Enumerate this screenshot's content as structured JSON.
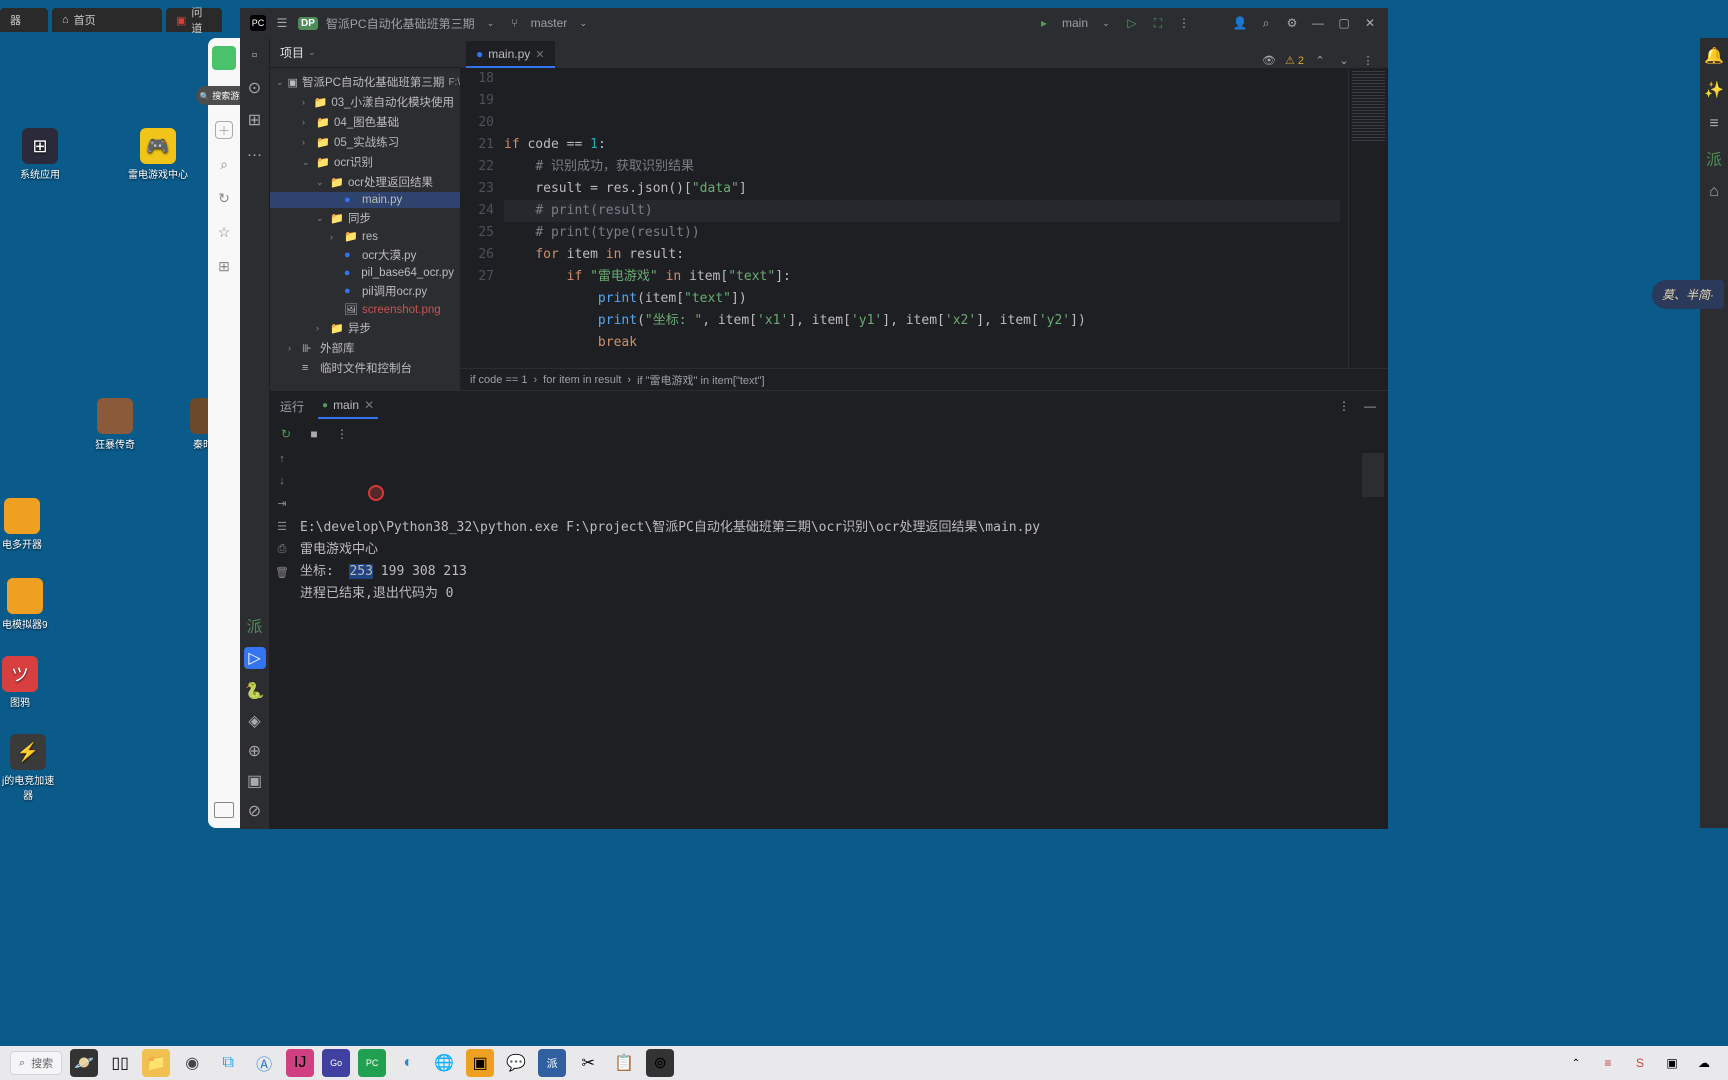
{
  "browser_tabs": [
    {
      "icon": "器",
      "label": "器"
    },
    {
      "icon": "⌂",
      "label": "首页"
    },
    {
      "icon": "▣",
      "label": "问道"
    }
  ],
  "desktop_icons": {
    "system": "系统应用",
    "leidian": "雷电游戏中心",
    "duokai": "电多开器",
    "simulator": "电模拟器9",
    "tuya": "图鸦",
    "booster": "j的电竞加速\n器",
    "kuangbao": "狂暴传奇",
    "qinshi": "秦时传"
  },
  "side_app": {
    "search": "搜索游戏"
  },
  "titlebar": {
    "project": "智派PC自动化基础班第三期",
    "branch": "master",
    "run_config": "main"
  },
  "tree": {
    "header": "项目",
    "root": "智派PC自动化基础班第三期",
    "root_suffix": "F:\\",
    "items": [
      {
        "indent": 1,
        "arrow": "›",
        "icon": "📁",
        "name": "03_小漾自动化模块使用"
      },
      {
        "indent": 1,
        "arrow": "›",
        "icon": "📁",
        "name": "04_图色基础"
      },
      {
        "indent": 1,
        "arrow": "›",
        "icon": "📁",
        "name": "05_实战练习"
      },
      {
        "indent": 1,
        "arrow": "⌄",
        "icon": "📁",
        "name": "ocr识别"
      },
      {
        "indent": 2,
        "arrow": "⌄",
        "icon": "📁",
        "name": "ocr处理返回结果"
      },
      {
        "indent": 3,
        "arrow": "",
        "icon": "py",
        "name": "main.py",
        "selected": true
      },
      {
        "indent": 2,
        "arrow": "⌄",
        "icon": "📁",
        "name": "同步"
      },
      {
        "indent": 3,
        "arrow": "›",
        "icon": "📁",
        "name": "res"
      },
      {
        "indent": 3,
        "arrow": "",
        "icon": "py",
        "name": "ocr大漠.py"
      },
      {
        "indent": 3,
        "arrow": "",
        "icon": "py",
        "name": "pil_base64_ocr.py"
      },
      {
        "indent": 3,
        "arrow": "",
        "icon": "py",
        "name": "pil调用ocr.py"
      },
      {
        "indent": 3,
        "arrow": "",
        "icon": "🖼",
        "name": "screenshot.png",
        "color": "#c75450"
      },
      {
        "indent": 2,
        "arrow": "›",
        "icon": "📁",
        "name": "异步"
      },
      {
        "indent": 0,
        "arrow": "›",
        "icon": "⊪",
        "name": "外部库"
      },
      {
        "indent": 0,
        "arrow": "",
        "icon": "≡",
        "name": "临时文件和控制台"
      }
    ]
  },
  "editor": {
    "tab": "main.py",
    "warnings": "2",
    "lines": [
      {
        "n": 18,
        "html": "<span class='kw'>if</span> code == <span class='num'>1</span>:"
      },
      {
        "n": 19,
        "html": "    <span class='com'># 识别成功，获取识别结果</span>"
      },
      {
        "n": 20,
        "html": "    result = res.json()[<span class='str'>\"data\"</span>]"
      },
      {
        "n": 21,
        "html": "    <span class='com'># print(result)</span>"
      },
      {
        "n": 22,
        "html": "    <span class='com'># print(type(result))</span>"
      },
      {
        "n": 23,
        "html": "    <span class='kw'>for</span> item <span class='kw'>in</span> result:"
      },
      {
        "n": 24,
        "html": "        <span class='kw'>if</span> <span class='str'>\"雷电游戏\"</span> <span class='kw'>in</span> item[<span class='str'>\"text\"</span>]:"
      },
      {
        "n": 25,
        "html": "            <span class='fn'>print</span>(item[<span class='str'>\"text\"</span>])"
      },
      {
        "n": 26,
        "html": "            <span class='fn'>print</span>(<span class='str'>\"坐标: \"</span>, item[<span class='str'>'x1'</span>], item[<span class='str'>'y1'</span>], item[<span class='str'>'x2'</span>], item[<span class='str'>'y2'</span>])"
      },
      {
        "n": 27,
        "html": "            <span class='kw'>break</span>"
      }
    ],
    "highlight_line": 24,
    "breadcrumb": [
      "if code == 1",
      "for item in result",
      "if \"雷电游戏\" in item[\"text\"]"
    ]
  },
  "run": {
    "label": "运行",
    "tab": "main",
    "output": {
      "line1": "E:\\develop\\Python38_32\\python.exe F:\\project\\智派PC自动化基础班第三期\\ocr识别\\ocr处理返回结果\\main.py",
      "line2": "雷电游戏中心",
      "line3_prefix": "坐标:  ",
      "line3_sel": "253",
      "line3_rest": " 199 308 213",
      "line4": "",
      "line5": "进程已结束,退出代码为 0"
    }
  },
  "floating_badge": "莫、半简·",
  "taskbar": {
    "search": "搜索"
  }
}
